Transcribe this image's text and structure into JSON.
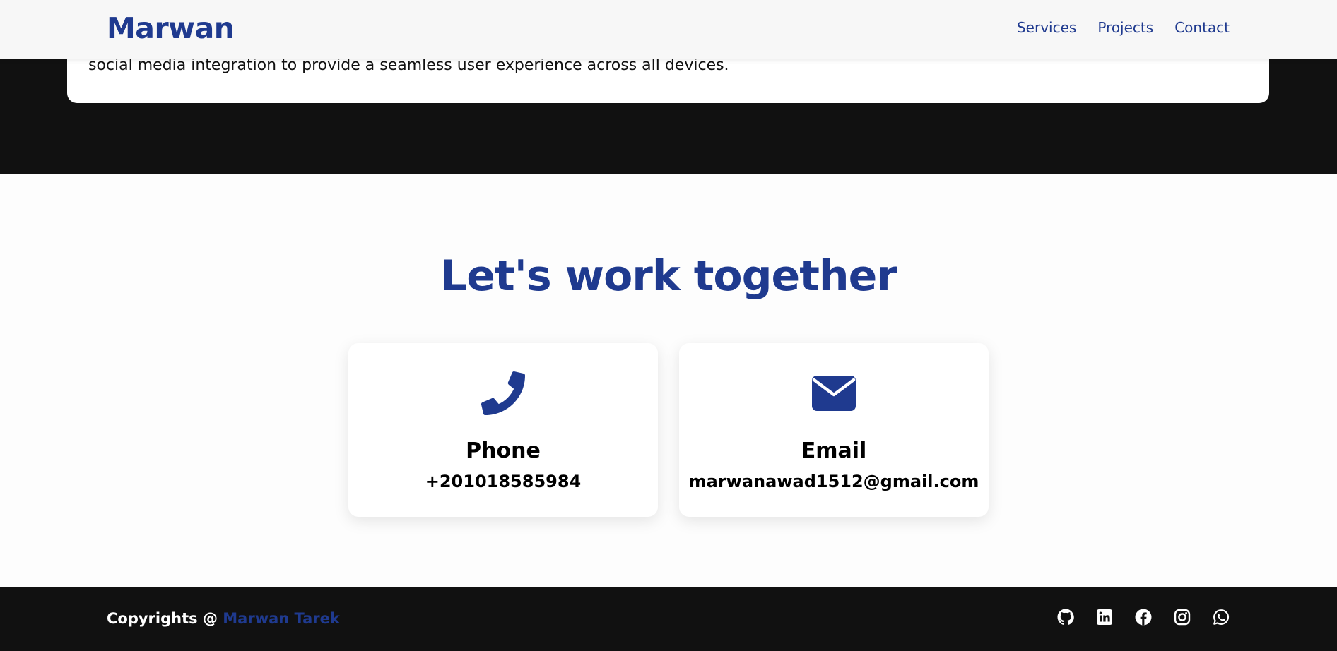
{
  "colors": {
    "accent": "#1f3a8f",
    "dark": "#111111",
    "text": "#000000",
    "background": "#ffffff"
  },
  "navbar": {
    "brand": "Marwan",
    "links": [
      "Services",
      "Projects",
      "Contact"
    ]
  },
  "project_card": {
    "description": "social media integration to provide a seamless user experience across all devices."
  },
  "contact": {
    "title": "Let's work together",
    "cards": [
      {
        "icon": "phone-icon",
        "label": "Phone",
        "value": "+201018585984"
      },
      {
        "icon": "envelope-icon",
        "label": "Email",
        "value": "marwanawad1512@gmail.com"
      }
    ]
  },
  "footer": {
    "copyright_prefix": "Copyrights @",
    "copyright_name": "Marwan Tarek",
    "social": [
      "github-icon",
      "linkedin-icon",
      "facebook-icon",
      "instagram-icon",
      "whatsapp-icon"
    ]
  }
}
